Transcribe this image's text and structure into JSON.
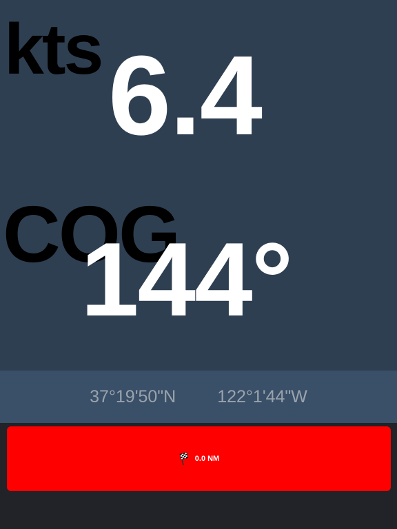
{
  "colors": {
    "main_background": "#2f3f52",
    "coord_bar_background": "#3a5068",
    "bottom_background": "#212328",
    "button_background": "#ff0000",
    "value_text": "#ffffff",
    "unit_text": "#000000",
    "coord_text": "#9aa3ad"
  },
  "speed": {
    "unit": "kts",
    "value": "6.4"
  },
  "course": {
    "unit": "COG",
    "value": "144°"
  },
  "position": {
    "latitude": "37°19'50\"N",
    "longitude": "122°1'44\"W"
  },
  "navigation": {
    "icon": "checkered-flag-icon",
    "distance": "0.0 NM"
  }
}
